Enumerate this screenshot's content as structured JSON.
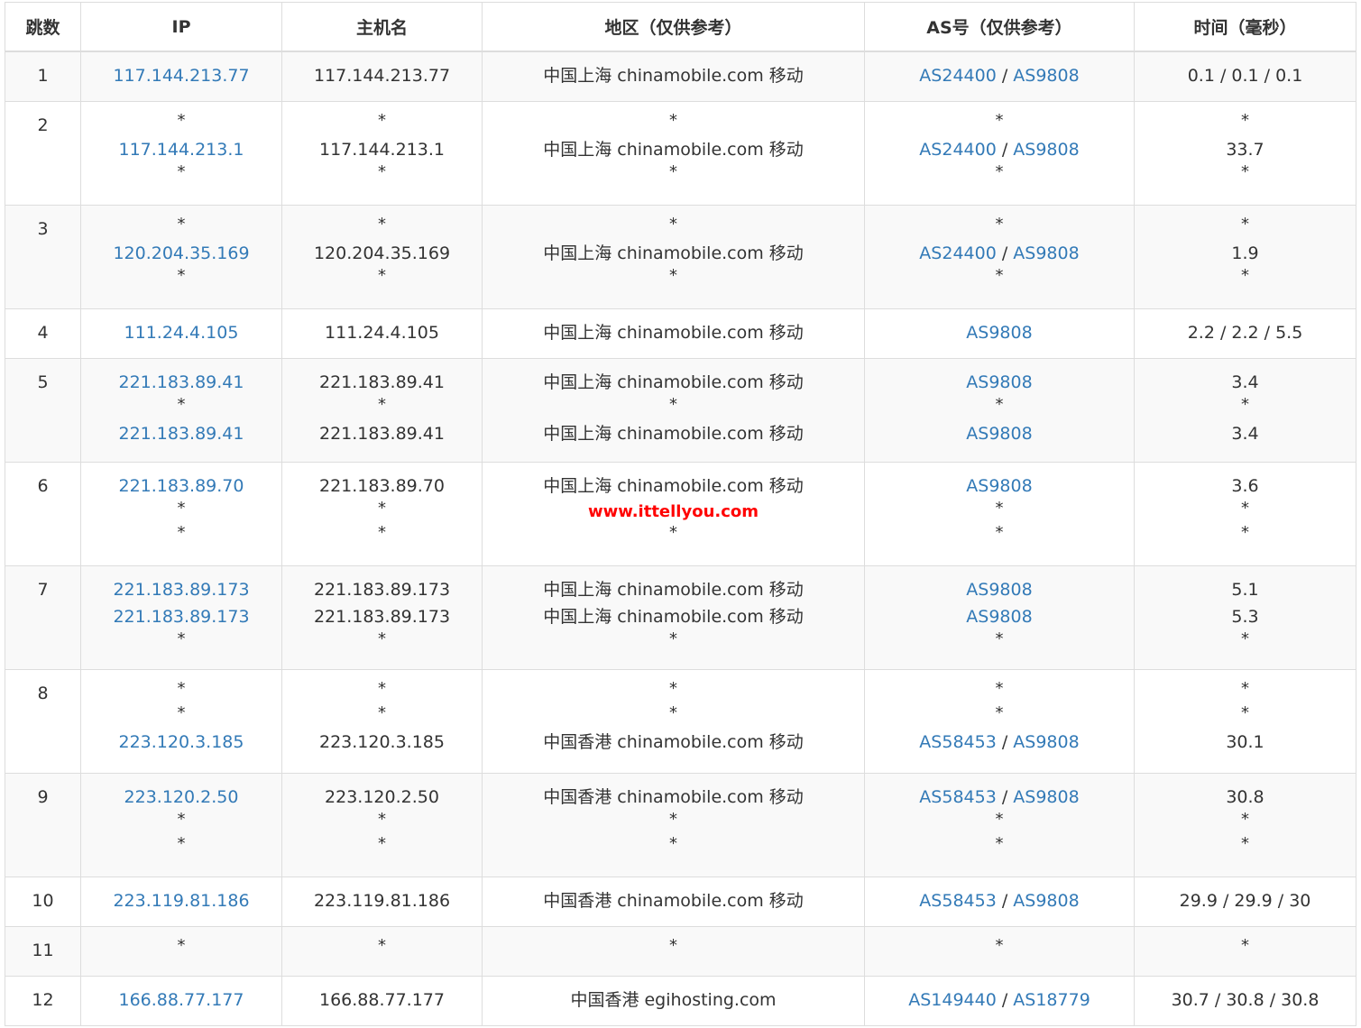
{
  "headers": [
    "跳数",
    "IP",
    "主机名",
    "地区（仅供参考）",
    "AS号（仅供参考）",
    "时间（毫秒）"
  ],
  "watermark": "www.ittellyou.com",
  "colors": {
    "link": "#337ab7",
    "watermark": "#ff0000",
    "stripe": "#f9f9f9",
    "border": "#dddddd"
  },
  "rows": [
    {
      "hop": "1",
      "lines": [
        {
          "ip": "117.144.213.77",
          "host": "117.144.213.77",
          "region": "中国上海 chinamobile.com 移动",
          "as": [
            "AS24400",
            "AS9808"
          ],
          "time": "0.1 / 0.1 / 0.1"
        }
      ]
    },
    {
      "hop": "2",
      "lines": [
        {
          "star": true
        },
        {
          "ip": "117.144.213.1",
          "host": "117.144.213.1",
          "region": "中国上海 chinamobile.com 移动",
          "as": [
            "AS24400",
            "AS9808"
          ],
          "time": "33.7"
        },
        {
          "star": true
        }
      ]
    },
    {
      "hop": "3",
      "lines": [
        {
          "star": true
        },
        {
          "ip": "120.204.35.169",
          "host": "120.204.35.169",
          "region": "中国上海 chinamobile.com 移动",
          "as": [
            "AS24400",
            "AS9808"
          ],
          "time": "1.9"
        },
        {
          "star": true
        }
      ]
    },
    {
      "hop": "4",
      "lines": [
        {
          "ip": "111.24.4.105",
          "host": "111.24.4.105",
          "region": "中国上海 chinamobile.com 移动",
          "as": [
            "AS9808"
          ],
          "time": "2.2 / 2.2 / 5.5"
        }
      ]
    },
    {
      "hop": "5",
      "lines": [
        {
          "ip": "221.183.89.41",
          "host": "221.183.89.41",
          "region": "中国上海 chinamobile.com 移动",
          "as": [
            "AS9808"
          ],
          "time": "3.4"
        },
        {
          "star": true
        },
        {
          "ip": "221.183.89.41",
          "host": "221.183.89.41",
          "region": "中国上海 chinamobile.com 移动",
          "as": [
            "AS9808"
          ],
          "time": "3.4"
        }
      ]
    },
    {
      "hop": "6",
      "lines": [
        {
          "ip": "221.183.89.70",
          "host": "221.183.89.70",
          "region": "中国上海 chinamobile.com 移动",
          "as": [
            "AS9808"
          ],
          "time": "3.6"
        },
        {
          "star": true,
          "watermark": true
        },
        {
          "star": true
        }
      ]
    },
    {
      "hop": "7",
      "lines": [
        {
          "ip": "221.183.89.173",
          "host": "221.183.89.173",
          "region": "中国上海 chinamobile.com 移动",
          "as": [
            "AS9808"
          ],
          "time": "5.1"
        },
        {
          "ip": "221.183.89.173",
          "host": "221.183.89.173",
          "region": "中国上海 chinamobile.com 移动",
          "as": [
            "AS9808"
          ],
          "time": "5.3"
        },
        {
          "star": true
        }
      ]
    },
    {
      "hop": "8",
      "lines": [
        {
          "star": true
        },
        {
          "star": true
        },
        {
          "ip": "223.120.3.185",
          "host": "223.120.3.185",
          "region": "中国香港 chinamobile.com 移动",
          "as": [
            "AS58453",
            "AS9808"
          ],
          "time": "30.1"
        }
      ]
    },
    {
      "hop": "9",
      "lines": [
        {
          "ip": "223.120.2.50",
          "host": "223.120.2.50",
          "region": "中国香港 chinamobile.com 移动",
          "as": [
            "AS58453",
            "AS9808"
          ],
          "time": "30.8"
        },
        {
          "star": true
        },
        {
          "star": true
        }
      ]
    },
    {
      "hop": "10",
      "lines": [
        {
          "ip": "223.119.81.186",
          "host": "223.119.81.186",
          "region": "中国香港 chinamobile.com 移动",
          "as": [
            "AS58453",
            "AS9808"
          ],
          "time": "29.9 / 29.9 / 30"
        }
      ]
    },
    {
      "hop": "11",
      "lines": [
        {
          "star": true
        }
      ]
    },
    {
      "hop": "12",
      "lines": [
        {
          "ip": "166.88.77.177",
          "host": "166.88.77.177",
          "region": "中国香港 egihosting.com",
          "as": [
            "AS149440",
            "AS18779"
          ],
          "time": "30.7 / 30.8 / 30.8"
        }
      ]
    }
  ]
}
